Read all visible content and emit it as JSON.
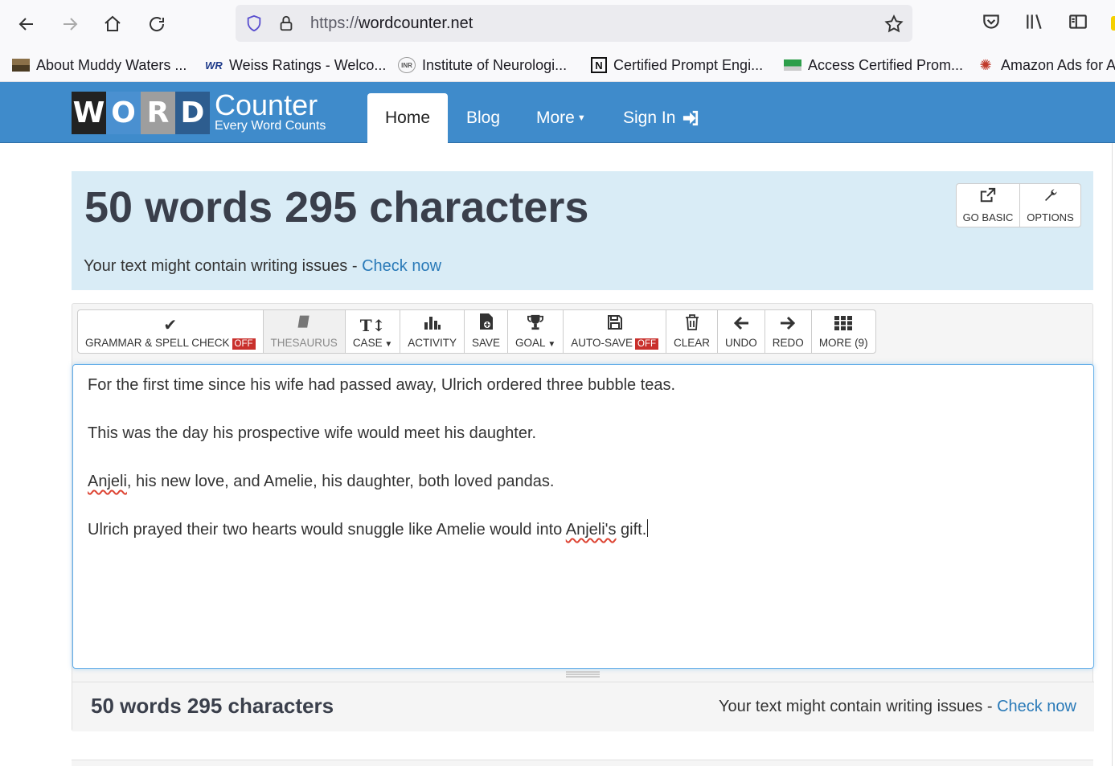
{
  "browser": {
    "url_protocol": "https://",
    "url_host": "wordcounter.net",
    "bookmarks": [
      {
        "label": "About Muddy Waters ...",
        "icon": "landscape-icon"
      },
      {
        "label": "Weiss Ratings - Welco...",
        "icon": "weiss-icon"
      },
      {
        "label": "Institute of Neurologi...",
        "icon": "inr-icon"
      },
      {
        "label": "Certified Prompt Engi...",
        "icon": "notion-icon"
      },
      {
        "label": "Access Certified Prom...",
        "icon": "flag-icon"
      },
      {
        "label": "Amazon Ads for A",
        "icon": "sun-icon"
      }
    ]
  },
  "site": {
    "logo_letters": [
      "W",
      "O",
      "R",
      "D"
    ],
    "logo_colors": [
      "#222222",
      "#4a90d0",
      "#9e9e9e",
      "#2d5d8f"
    ],
    "logo_name": "Counter",
    "logo_tagline": "Every Word Counts",
    "nav": {
      "home": "Home",
      "blog": "Blog",
      "more": "More",
      "signin": "Sign In"
    }
  },
  "hero": {
    "title": "50 words 295 characters",
    "issues_text": "Your text might contain writing issues - ",
    "check_link": "Check now",
    "go_basic": "GO BASIC",
    "options": "OPTIONS"
  },
  "toolbar": {
    "grammar": "GRAMMAR & SPELL CHECK",
    "grammar_state": "OFF",
    "thesaurus": "THESAURUS",
    "case": "CASE",
    "activity": "ACTIVITY",
    "save": "SAVE",
    "goal": "GOAL",
    "autosave": "AUTO-SAVE",
    "autosave_state": "OFF",
    "clear": "CLEAR",
    "undo": "UNDO",
    "redo": "REDO",
    "more": "MORE (9)"
  },
  "editor": {
    "p1": "For the first time since his wife had passed away, Ulrich ordered three bubble teas.",
    "p2": "This was the day his prospective wife would meet his daughter.",
    "p3_misspelled": "Anjeli",
    "p3_rest": ", his new love, and Amelie, his daughter, both loved pandas.",
    "p4_start": "Ulrich prayed their two hearts would snuggle like Amelie would into ",
    "p4_misspelled": "Anjeli's",
    "p4_end": " gift."
  },
  "footer": {
    "count": "50 words 295 characters",
    "issues_text": "Your text might contain writing issues - ",
    "check_link": "Check now"
  },
  "colors": {
    "nav_blue": "#3f8bcb",
    "hero_bg": "#d9ecf6",
    "off_red": "#c9302c",
    "link_blue": "#2a7ab8"
  }
}
